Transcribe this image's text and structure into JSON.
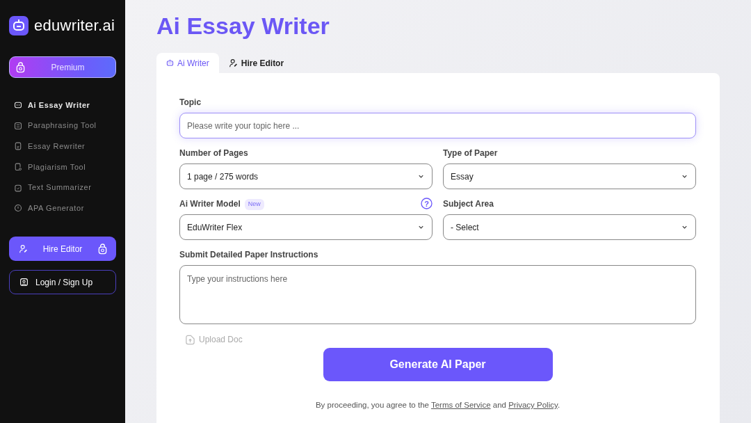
{
  "sidebar": {
    "logo_text": "eduwriter.ai",
    "premium_button": "Premium",
    "items": [
      {
        "label": "Ai Essay Writer",
        "selected": true
      },
      {
        "label": "Paraphrasing Tool",
        "selected": false
      },
      {
        "label": "Essay Rewriter",
        "selected": false
      },
      {
        "label": "Plagiarism Tool",
        "selected": false
      },
      {
        "label": "Text Summarizer",
        "selected": false
      },
      {
        "label": "APA Generator",
        "selected": false
      }
    ],
    "hire_button": "Hire Editor",
    "login_button": "Login / Sign Up"
  },
  "page_title": "Ai Essay Writer",
  "tabs": [
    {
      "label": "Ai Writer",
      "selected": true
    },
    {
      "label": "Hire Editor",
      "selected": false
    }
  ],
  "form": {
    "topic": {
      "label": "Topic",
      "placeholder": "Please write your topic here ..."
    },
    "pages": {
      "label": "Number of Pages",
      "value": "1 page / 275 words"
    },
    "paper_type": {
      "label": "Type of Paper",
      "value": "Essay"
    },
    "model": {
      "label": "Ai Writer Model",
      "badge": "New",
      "help": "?",
      "value": "EduWriter Flex"
    },
    "subject": {
      "label": "Subject Area",
      "value": "- Select"
    },
    "instructions": {
      "label": "Submit Detailed Paper Instructions",
      "placeholder": "Type your instructions here"
    },
    "upload": "Upload Doc",
    "generate_button": "Generate AI Paper",
    "legal": [
      {
        "kind": "text",
        "text": "By proceeding, you agree to the "
      },
      {
        "kind": "link",
        "text": "Terms of Service"
      },
      {
        "kind": "text",
        "text": " and "
      },
      {
        "kind": "link",
        "text": "Privacy Policy"
      },
      {
        "kind": "text",
        "text": "."
      }
    ]
  }
}
